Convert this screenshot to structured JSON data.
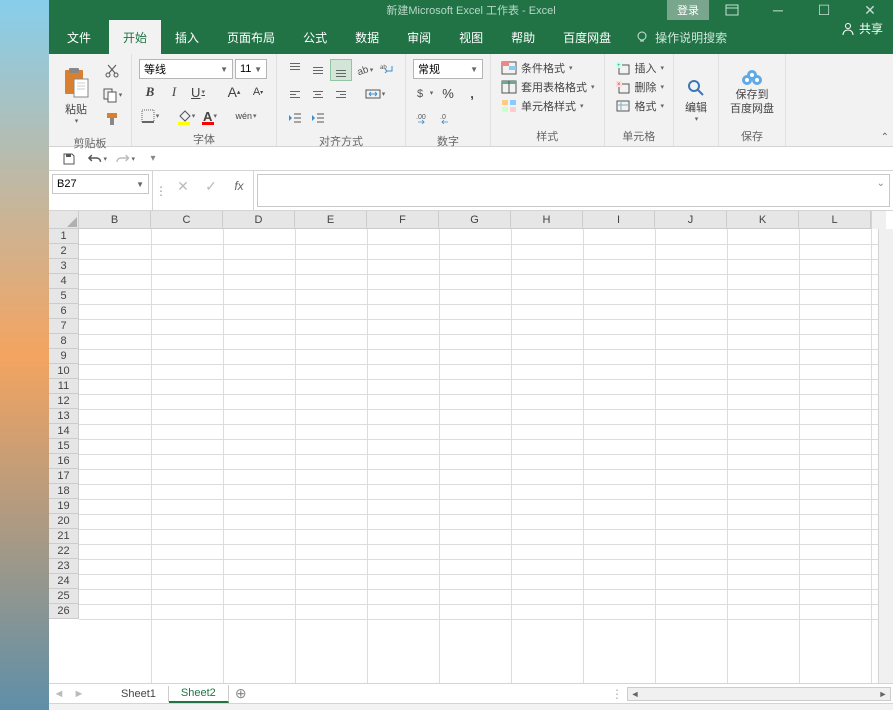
{
  "title": "新建Microsoft Excel 工作表  -  Excel",
  "login": "登录",
  "tabs": {
    "file": "文件",
    "home": "开始",
    "insert": "插入",
    "layout": "页面布局",
    "formulas": "公式",
    "data": "数据",
    "review": "审阅",
    "view": "视图",
    "help": "帮助",
    "baidu": "百度网盘",
    "tellme": "操作说明搜索"
  },
  "share": "共享",
  "ribbon": {
    "clipboard": {
      "label": "剪贴板",
      "paste": "粘贴"
    },
    "font": {
      "label": "字体",
      "name": "等线",
      "size": "11"
    },
    "align": {
      "label": "对齐方式"
    },
    "number": {
      "label": "数字",
      "format": "常规"
    },
    "styles": {
      "label": "样式",
      "cond": "条件格式",
      "table": "套用表格格式",
      "cell": "单元格样式"
    },
    "cells": {
      "label": "单元格",
      "insert": "插入",
      "delete": "删除",
      "format": "格式"
    },
    "editing": {
      "label": "编辑"
    },
    "baidu": {
      "label": "保存",
      "btn": "保存到\n百度网盘"
    }
  },
  "namebox": "B27",
  "sheets": {
    "s1": "Sheet1",
    "s2": "Sheet2"
  },
  "cols": [
    "B",
    "C",
    "D",
    "E",
    "F",
    "G",
    "H",
    "I",
    "J",
    "K",
    "L"
  ],
  "rowCount": 26
}
